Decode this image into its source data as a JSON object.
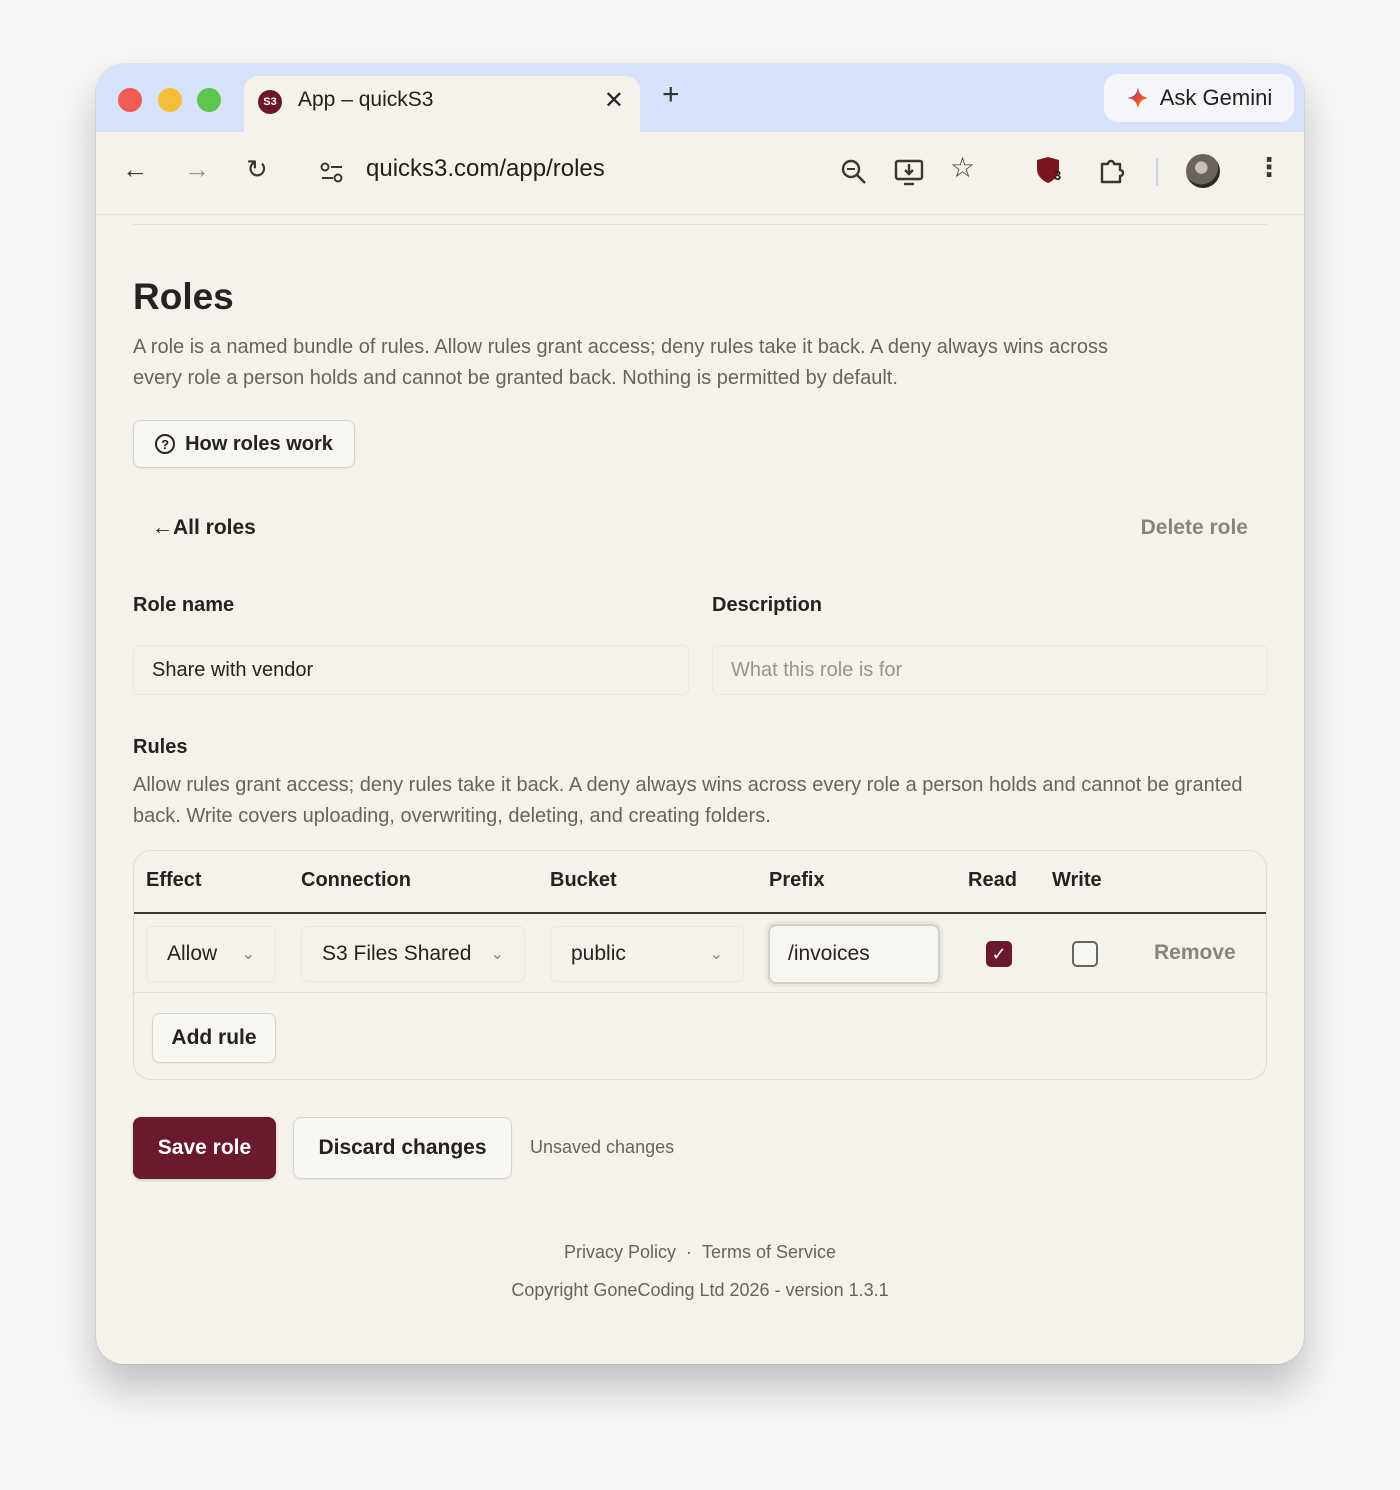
{
  "browser": {
    "tab_title": "App – quickS3",
    "favicon_text": "S3",
    "ask_gemini": "Ask Gemini",
    "url": "quicks3.com/app/roles",
    "extension_badge": "3"
  },
  "page": {
    "title": "Roles",
    "description": "A role is a named bundle of rules. Allow rules grant access; deny rules take it back. A deny always wins across every role a person holds and cannot be granted back. Nothing is permitted by default.",
    "how_roles_work": "How roles work",
    "all_roles": "All roles",
    "delete_role": "Delete role"
  },
  "form": {
    "role_name_label": "Role name",
    "role_name_value": "Share with vendor",
    "description_label": "Description",
    "description_placeholder": "What this role is for"
  },
  "rules": {
    "title": "Rules",
    "description": "Allow rules grant access; deny rules take it back. A deny always wins across every role a person holds and cannot be granted back. Write covers uploading, overwriting, deleting, and creating folders.",
    "columns": {
      "effect": "Effect",
      "connection": "Connection",
      "bucket": "Bucket",
      "prefix": "Prefix",
      "read": "Read",
      "write": "Write"
    },
    "row": {
      "effect": "Allow",
      "connection": "S3 Files Shared",
      "bucket": "public",
      "prefix": "/invoices",
      "read": true,
      "write": false,
      "remove": "Remove"
    },
    "add_rule": "Add rule"
  },
  "actions": {
    "save": "Save role",
    "discard": "Discard changes",
    "status": "Unsaved changes"
  },
  "footer": {
    "privacy": "Privacy Policy",
    "separator": "·",
    "terms": "Terms of Service",
    "copyright": "Copyright GoneCoding Ltd 2026 - version 1.3.1"
  },
  "colors": {
    "brand": "#6b1a2d",
    "page_bg": "#f5f2eb",
    "tabstrip": "#d6e2fa"
  }
}
